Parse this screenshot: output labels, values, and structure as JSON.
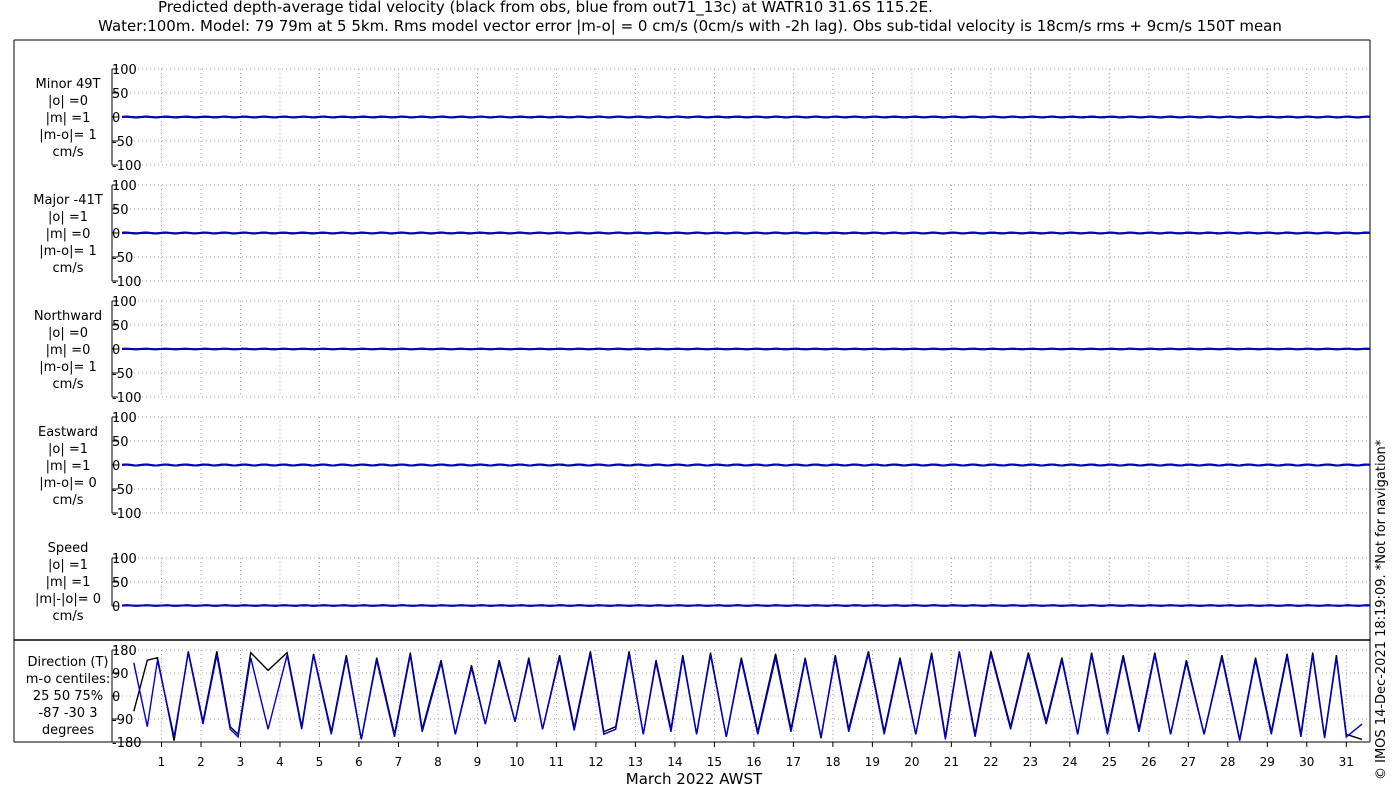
{
  "title_line1": "Predicted depth-average tidal velocity (black from obs, blue from out71_13c) at WATR10 31.6S 115.2E.",
  "title_line2": "Water:100m. Model: 79 79m at 5 5km. Rms model vector error |m-o| = 0 cm/s (0cm/s with -2h lag). Obs sub-tidal velocity is 18cm/s rms + 9cm/s 150T mean",
  "credit": "© IMOS 14-Dec-2021 18:19:09. *Not for navigation*",
  "xlabel": "March 2022 AWST",
  "colors": {
    "obs": "#000000",
    "model": "#0000cc",
    "grid": "#888888"
  },
  "chart_data": [
    {
      "type": "line",
      "panel": "minor",
      "label_lines": [
        "Minor 49T",
        "|o| =0",
        "|m| =1",
        "|m-o|= 1",
        "cm/s"
      ],
      "yticks": [
        "100",
        "50",
        "0",
        "-50",
        "-100"
      ],
      "ylim": [
        -100,
        100
      ],
      "x_ticks": [
        "1",
        "2",
        "3",
        "4",
        "5",
        "6",
        "7",
        "8",
        "9",
        "10",
        "11",
        "12",
        "13",
        "14",
        "15",
        "16",
        "17",
        "18",
        "19",
        "20",
        "21",
        "22",
        "23",
        "24",
        "25",
        "26",
        "27",
        "28",
        "29",
        "30",
        "31"
      ],
      "series": [
        {
          "name": "obs",
          "amplitude": 0.4
        },
        {
          "name": "model",
          "amplitude": 1
        }
      ]
    },
    {
      "type": "line",
      "panel": "major",
      "label_lines": [
        "Major -41T",
        "|o| =1",
        "|m| =0",
        "|m-o|= 1",
        "cm/s"
      ],
      "yticks": [
        "100",
        "50",
        "0",
        "-50",
        "-100"
      ],
      "ylim": [
        -100,
        100
      ],
      "series": [
        {
          "name": "obs",
          "amplitude": 1
        },
        {
          "name": "model",
          "amplitude": 0.4
        }
      ]
    },
    {
      "type": "line",
      "panel": "northward",
      "label_lines": [
        "Northward",
        "|o| =0",
        "|m| =0",
        "|m-o|= 1",
        "cm/s"
      ],
      "yticks": [
        "100",
        "50",
        "0",
        "-50",
        "-100"
      ],
      "ylim": [
        -100,
        100
      ],
      "series": [
        {
          "name": "obs",
          "amplitude": 0.4
        },
        {
          "name": "model",
          "amplitude": 0.4
        }
      ]
    },
    {
      "type": "line",
      "panel": "eastward",
      "label_lines": [
        "Eastward",
        "|o| =1",
        "|m| =1",
        "|m-o|= 0",
        "cm/s"
      ],
      "yticks": [
        "100",
        "50",
        "0",
        "-50",
        "-100"
      ],
      "ylim": [
        -100,
        100
      ],
      "series": [
        {
          "name": "obs",
          "amplitude": 1
        },
        {
          "name": "model",
          "amplitude": 1
        }
      ]
    },
    {
      "type": "line",
      "panel": "speed",
      "label_lines": [
        "Speed",
        "|o| =1",
        "|m| =1",
        "|m|-|o|= 0",
        "cm/s"
      ],
      "yticks": [
        "100",
        "50",
        "0"
      ],
      "ylim": [
        0,
        100
      ],
      "series": [
        {
          "name": "obs",
          "mean": 1
        },
        {
          "name": "model",
          "mean": 1
        }
      ]
    },
    {
      "type": "line",
      "panel": "direction",
      "label_lines": [
        "Direction (T)",
        "m-o centiles:",
        "25  50  75%",
        "-87  -30   3",
        "degrees"
      ],
      "yticks": [
        "180",
        "90",
        "0",
        "-90",
        "-180"
      ],
      "ylim": [
        -180,
        180
      ],
      "x": [
        0.3,
        0.64,
        0.9,
        1.32,
        1.68,
        2.05,
        2.4,
        2.74,
        2.94,
        3.26,
        3.7,
        4.18,
        4.55,
        4.85,
        5.3,
        5.68,
        6.06,
        6.45,
        6.9,
        7.3,
        7.6,
        8.08,
        8.44,
        8.85,
        9.2,
        9.55,
        9.95,
        10.3,
        10.65,
        11.08,
        11.45,
        11.86,
        12.2,
        12.5,
        12.84,
        13.2,
        13.52,
        13.9,
        14.2,
        14.55,
        14.9,
        15.3,
        15.68,
        16.1,
        16.55,
        16.94,
        17.3,
        17.7,
        18.06,
        18.4,
        18.9,
        19.3,
        19.7,
        20.1,
        20.5,
        20.85,
        21.2,
        21.6,
        22.0,
        22.5,
        22.95,
        23.4,
        23.8,
        24.2,
        24.55,
        24.95,
        25.35,
        25.75,
        26.15,
        26.55,
        26.95,
        27.4,
        27.85,
        28.3,
        28.7,
        29.1,
        29.5,
        29.85,
        30.15,
        30.45,
        30.75,
        31.0,
        31.4
      ],
      "series": [
        {
          "name": "obs",
          "values": [
            -60,
            140,
            150,
            -175,
            175,
            -100,
            175,
            -120,
            -150,
            170,
            100,
            170,
            -120,
            165,
            -140,
            160,
            -170,
            150,
            -150,
            170,
            -130,
            140,
            -150,
            120,
            -110,
            140,
            -100,
            150,
            -130,
            160,
            -125,
            175,
            -140,
            -120,
            175,
            -150,
            140,
            -130,
            160,
            -150,
            170,
            -160,
            150,
            -140,
            165,
            -130,
            150,
            -165,
            160,
            -130,
            175,
            -140,
            150,
            -150,
            170,
            -160,
            175,
            -150,
            175,
            -120,
            170,
            -100,
            150,
            -150,
            170,
            -140,
            160,
            -130,
            170,
            -150,
            140,
            -150,
            160,
            -170,
            150,
            -140,
            165,
            -150,
            170,
            -160,
            160,
            -150,
            -170
          ]
        },
        {
          "name": "model",
          "values": [
            130,
            -120,
            140,
            -160,
            170,
            -110,
            160,
            -130,
            -160,
            150,
            -130,
            160,
            -130,
            160,
            -150,
            150,
            -170,
            140,
            -160,
            160,
            -140,
            130,
            -150,
            110,
            -110,
            130,
            -100,
            140,
            -130,
            150,
            -135,
            165,
            -150,
            -130,
            165,
            -150,
            130,
            -140,
            150,
            -150,
            160,
            -160,
            140,
            -150,
            150,
            -140,
            140,
            -160,
            150,
            -140,
            165,
            -150,
            140,
            -150,
            160,
            -170,
            170,
            -160,
            165,
            -130,
            160,
            -110,
            140,
            -150,
            160,
            -150,
            150,
            -140,
            160,
            -150,
            130,
            -150,
            150,
            -175,
            140,
            -150,
            155,
            -160,
            160,
            -165,
            150,
            -160,
            -110
          ]
        }
      ]
    }
  ]
}
